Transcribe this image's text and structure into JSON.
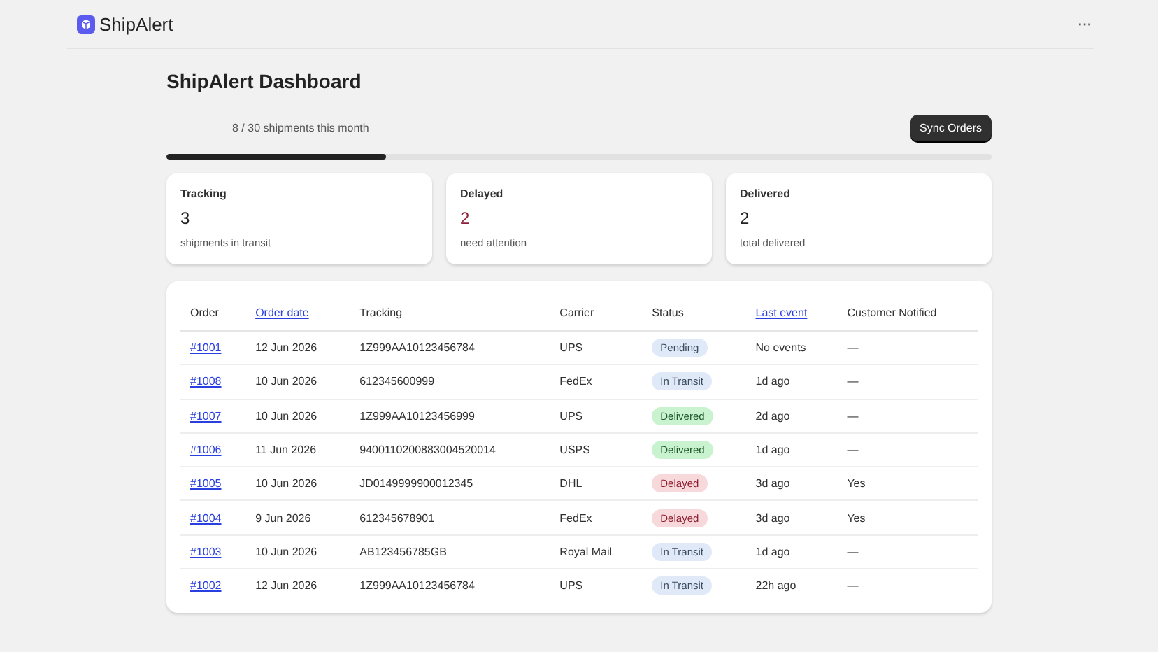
{
  "app": {
    "name": "ShipAlert",
    "menu": "···"
  },
  "page": {
    "title": "ShipAlert Dashboard"
  },
  "usage": {
    "text": "8 / 30 shipments this month",
    "level": 0.2667
  },
  "sync_button": "Sync Orders",
  "stats": [
    {
      "label": "Tracking",
      "value": "3",
      "caption": "shipments in transit",
      "kind": "default"
    },
    {
      "label": "Delayed",
      "value": "2",
      "caption": "need attention",
      "kind": "critical"
    },
    {
      "label": "Delivered",
      "value": "2",
      "caption": "total delivered",
      "kind": "default"
    }
  ],
  "table": {
    "columns": [
      {
        "label": "Order",
        "kind": "plain"
      },
      {
        "label": "Order date",
        "kind": "sort"
      },
      {
        "label": "Tracking",
        "kind": "plain"
      },
      {
        "label": "Carrier",
        "kind": "plain"
      },
      {
        "label": "Status",
        "kind": "plain"
      },
      {
        "label": "Last event",
        "kind": "sort"
      },
      {
        "label": "Customer Notified",
        "kind": "plain"
      }
    ],
    "rows": [
      {
        "order": "#1001",
        "date": "12 Jun 2026",
        "tracking": "1Z999AA10123456784",
        "carrier": "UPS",
        "status": {
          "label": "Pending",
          "kind": "pending"
        },
        "last_event": "No events",
        "notified": "—"
      },
      {
        "order": "#1008",
        "date": "10 Jun 2026",
        "tracking": "612345600999",
        "carrier": "FedEx",
        "status": {
          "label": "In Transit",
          "kind": "transit"
        },
        "last_event": "1d ago",
        "notified": "—"
      },
      {
        "order": "#1007",
        "date": "10 Jun 2026",
        "tracking": "1Z999AA10123456999",
        "carrier": "UPS",
        "status": {
          "label": "Delivered",
          "kind": "delivered"
        },
        "last_event": "2d ago",
        "notified": "—"
      },
      {
        "order": "#1006",
        "date": "11 Jun 2026",
        "tracking": "9400110200883004520014",
        "carrier": "USPS",
        "status": {
          "label": "Delivered",
          "kind": "delivered"
        },
        "last_event": "1d ago",
        "notified": "—"
      },
      {
        "order": "#1005",
        "date": "10 Jun 2026",
        "tracking": "JD0149999900012345",
        "carrier": "DHL",
        "status": {
          "label": "Delayed",
          "kind": "delayed"
        },
        "last_event": "3d ago",
        "notified": "Yes"
      },
      {
        "order": "#1004",
        "date": "9 Jun 2026",
        "tracking": "612345678901",
        "carrier": "FedEx",
        "status": {
          "label": "Delayed",
          "kind": "delayed"
        },
        "last_event": "3d ago",
        "notified": "Yes"
      },
      {
        "order": "#1003",
        "date": "10 Jun 2026",
        "tracking": "AB123456785GB",
        "carrier": "Royal Mail",
        "status": {
          "label": "In Transit",
          "kind": "transit"
        },
        "last_event": "1d ago",
        "notified": "—"
      },
      {
        "order": "#1002",
        "date": "12 Jun 2026",
        "tracking": "1Z999AA10123456784",
        "carrier": "UPS",
        "status": {
          "label": "In Transit",
          "kind": "transit"
        },
        "last_event": "22h ago",
        "notified": "—"
      }
    ]
  }
}
